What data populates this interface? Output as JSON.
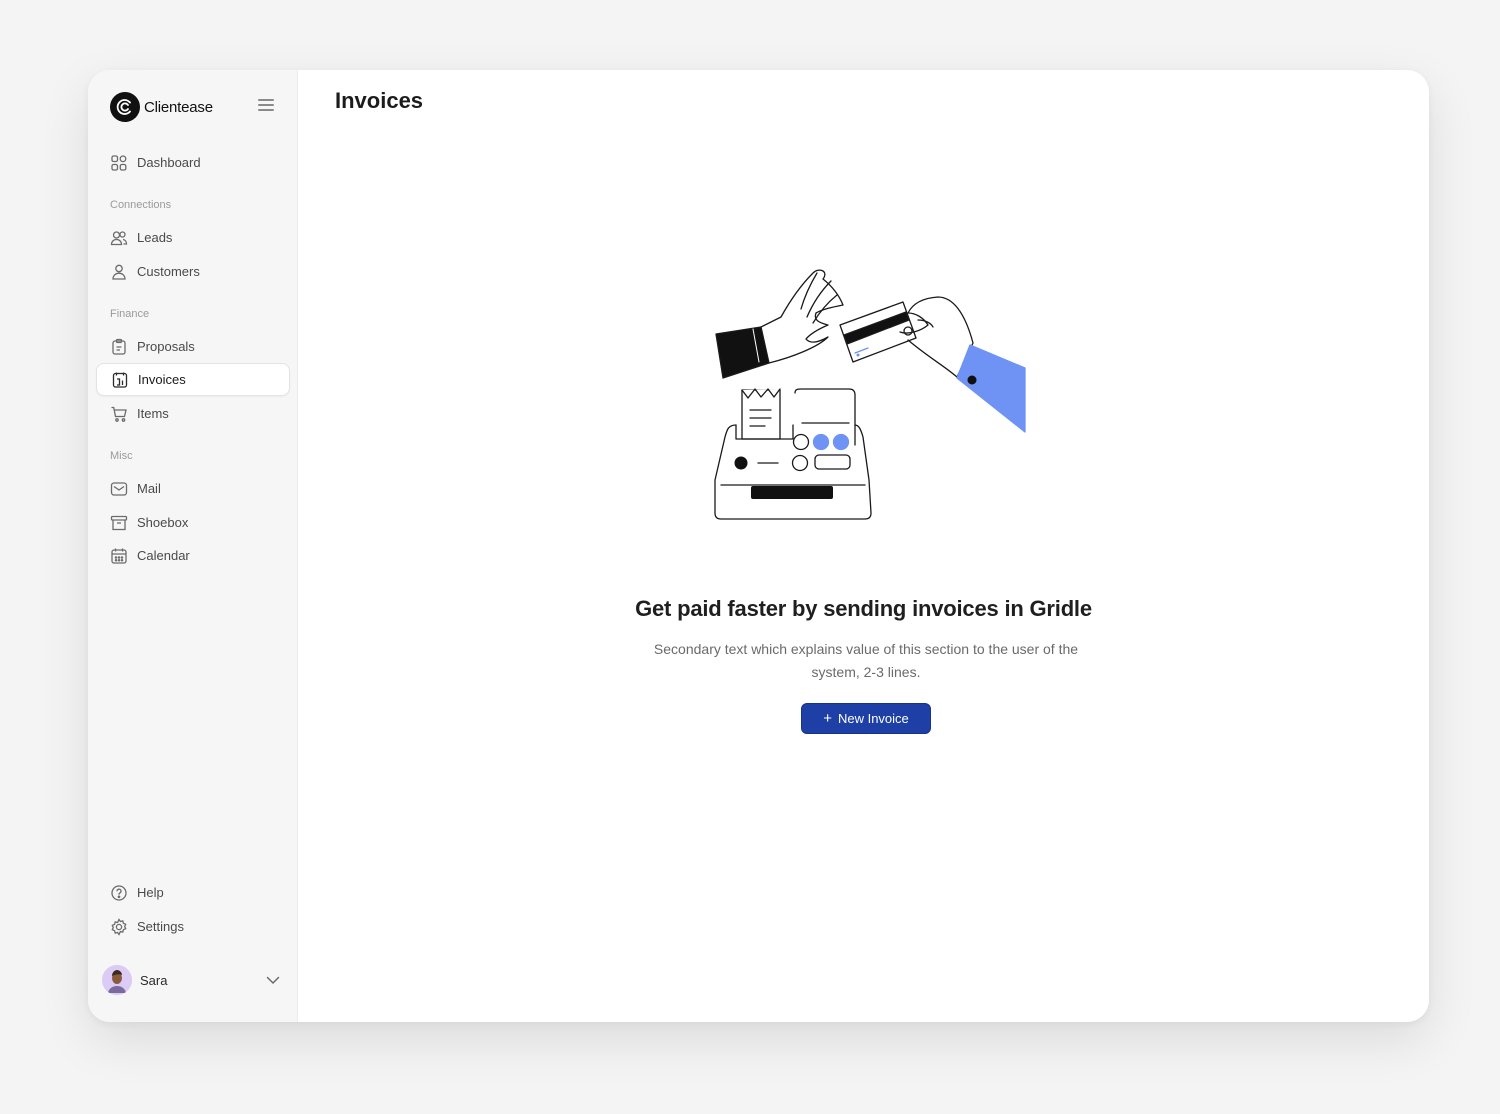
{
  "brand": {
    "name": "Clientease"
  },
  "sidebar": {
    "dashboard": "Dashboard",
    "sections": {
      "connections": "Connections",
      "finance": "Finance",
      "misc": "Misc"
    },
    "items": {
      "leads": "Leads",
      "customers": "Customers",
      "proposals": "Proposals",
      "invoices": "Invoices",
      "items": "Items",
      "mail": "Mail",
      "shoebox": "Shoebox",
      "calendar": "Calendar",
      "help": "Help",
      "settings": "Settings"
    },
    "active_item": "invoices",
    "user": {
      "name": "Sara"
    }
  },
  "main": {
    "title": "Invoices",
    "empty_state": {
      "heading": "Get paid faster by sending invoices in Gridle",
      "description": "Secondary text which explains value of this section to the user of the system, 2-3 lines.",
      "button_label": "New Invoice",
      "button_icon": "plus-icon"
    }
  },
  "colors": {
    "primary_button": "#1d3fa6",
    "illustration_accent": "#6f93f4",
    "sidebar_bg": "#f6f6f6"
  }
}
